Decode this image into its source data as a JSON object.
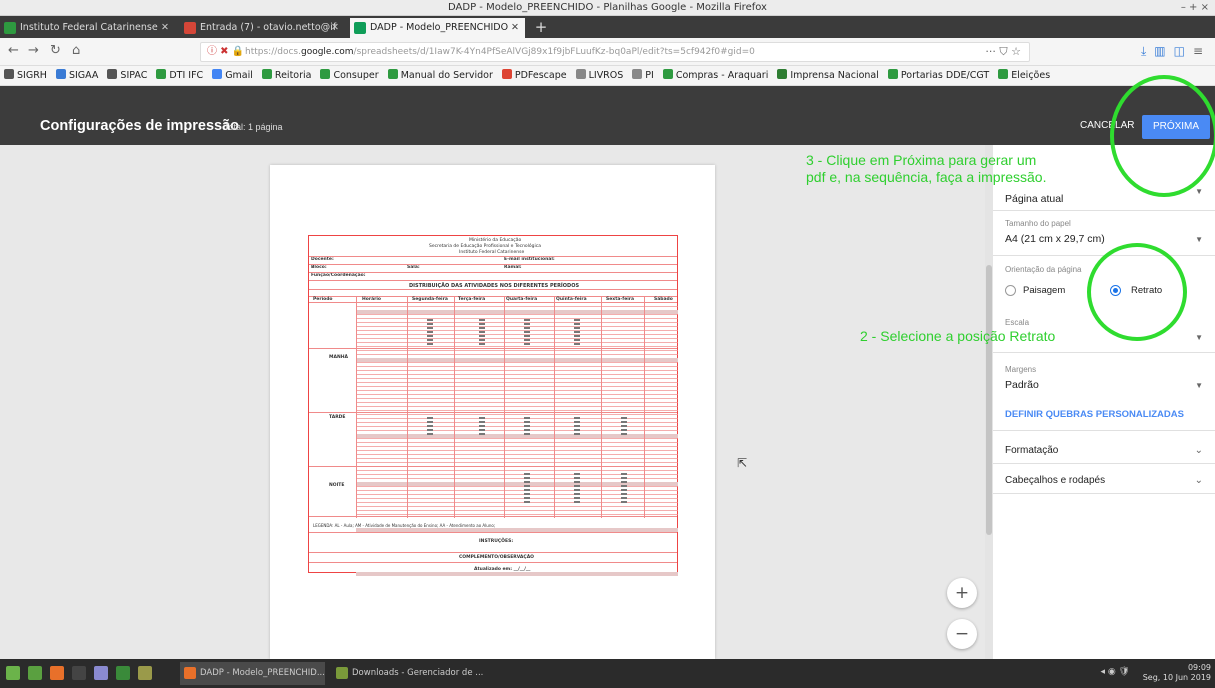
{
  "window": {
    "title": "DADP - Modelo_PREENCHIDO - Planilhas Google - Mozilla Firefox",
    "controls": "– + ×"
  },
  "tabs": [
    {
      "label": "Instituto Federal Catarinense",
      "color": "#2e9a40"
    },
    {
      "label": "Entrada (7) - otavio.netto@if",
      "color": "#d44638"
    },
    {
      "label": "DADP - Modelo_PREENCHIDO",
      "color": "#0f9d58"
    }
  ],
  "url": {
    "prefix": "https://docs.",
    "domain": "google.com",
    "path": "/spreadsheets/d/1Iaw7K-4Yn4PfSeAlVGj89x1f9jbFLuufKz-bq0aPl/edit?ts=5cf942f0#gid=0",
    "more": "···"
  },
  "bookmarks": [
    {
      "label": "SIGRH",
      "color": "#555"
    },
    {
      "label": "SIGAA",
      "color": "#3a7bd5"
    },
    {
      "label": "SIPAC",
      "color": "#555"
    },
    {
      "label": "DTI IFC",
      "color": "#2e9a40"
    },
    {
      "label": "Gmail",
      "color": "#4285f4"
    },
    {
      "label": "Reitoria",
      "color": "#2e9a40"
    },
    {
      "label": "Consuper",
      "color": "#2e9a40"
    },
    {
      "label": "Manual do Servidor",
      "color": "#2e9a40"
    },
    {
      "label": "PDFescape",
      "color": "#d43"
    },
    {
      "label": "LIVROS",
      "color": "#888"
    },
    {
      "label": "PI",
      "color": "#888"
    },
    {
      "label": "Compras - Araquari",
      "color": "#2e9a40"
    },
    {
      "label": "Imprensa Nacional",
      "color": "#2e7d32"
    },
    {
      "label": "Portarias DDE/CGT",
      "color": "#2e9a40"
    },
    {
      "label": "Eleições",
      "color": "#2e9a40"
    }
  ],
  "print_header": {
    "title": "Configurações de impressão",
    "total": "Total: 1 página",
    "cancel": "CANCELAR",
    "next": "PRÓXIMA"
  },
  "settings": {
    "print_value": "Página atual",
    "paper_label": "Tamanho do papel",
    "paper_value": "A4 (21 cm x 29,7 cm)",
    "orientation_label": "Orientação da página",
    "landscape": "Paisagem",
    "portrait": "Retrato",
    "scale_label": "Escala",
    "margins_label": "Margens",
    "margins_value": "Padrão",
    "breaks_link": "DEFINIR QUEBRAS PERSONALIZADAS",
    "formatting": "Formatação",
    "headers": "Cabeçalhos e rodapés"
  },
  "annotations": {
    "step3_line1": "3 - Clique em Próxima para gerar um",
    "step3_line2": "pdf e, na sequência, faça a impressão.",
    "step2": "2 - Selecione a posição Retrato"
  },
  "sheet": {
    "header1": "Ministério da Educação",
    "header2": "Secretaria de Educação Profissional e Tecnológica",
    "header3": "Instituto Federal Catarinense",
    "docente": "Docente:",
    "email": "E-mail institucional:",
    "bloco": "Bloco:",
    "sala": "Sala:",
    "ramal": "Ramal:",
    "funcao": "Função/Coordenação:",
    "title": "DISTRIBUIÇÃO DAS ATIVIDADES NOS DIFERENTES PERÍODOS",
    "columns": [
      "Período",
      "Horário",
      "Segunda-feira",
      "Terça-feira",
      "Quarta-feira",
      "Quinta-feira",
      "Sexta-feira",
      "Sábado"
    ],
    "periods": [
      "MANHÃ",
      "TARDE",
      "NOITE"
    ],
    "legend": "LEGENDA: AL - Aula; AM - Atividade de Manutenção do Ensino; AA - Atendimento ao Aluno;",
    "instr": "INSTRUÇÕES:",
    "compl": "COMPLEMENTO/OBSERVAÇÃO",
    "footer": "Atualizado em: __/__/__"
  },
  "taskbar": {
    "task1": "DADP - Modelo_PREENCHID...",
    "task2": "Downloads - Gerenciador de ...",
    "time": "09:09",
    "date": "Seg, 10 Jun 2019"
  },
  "colors": {
    "accent_blue": "#4a8af4",
    "annotation_green": "#2fcf2f",
    "header_dark": "#3c3c3c"
  }
}
